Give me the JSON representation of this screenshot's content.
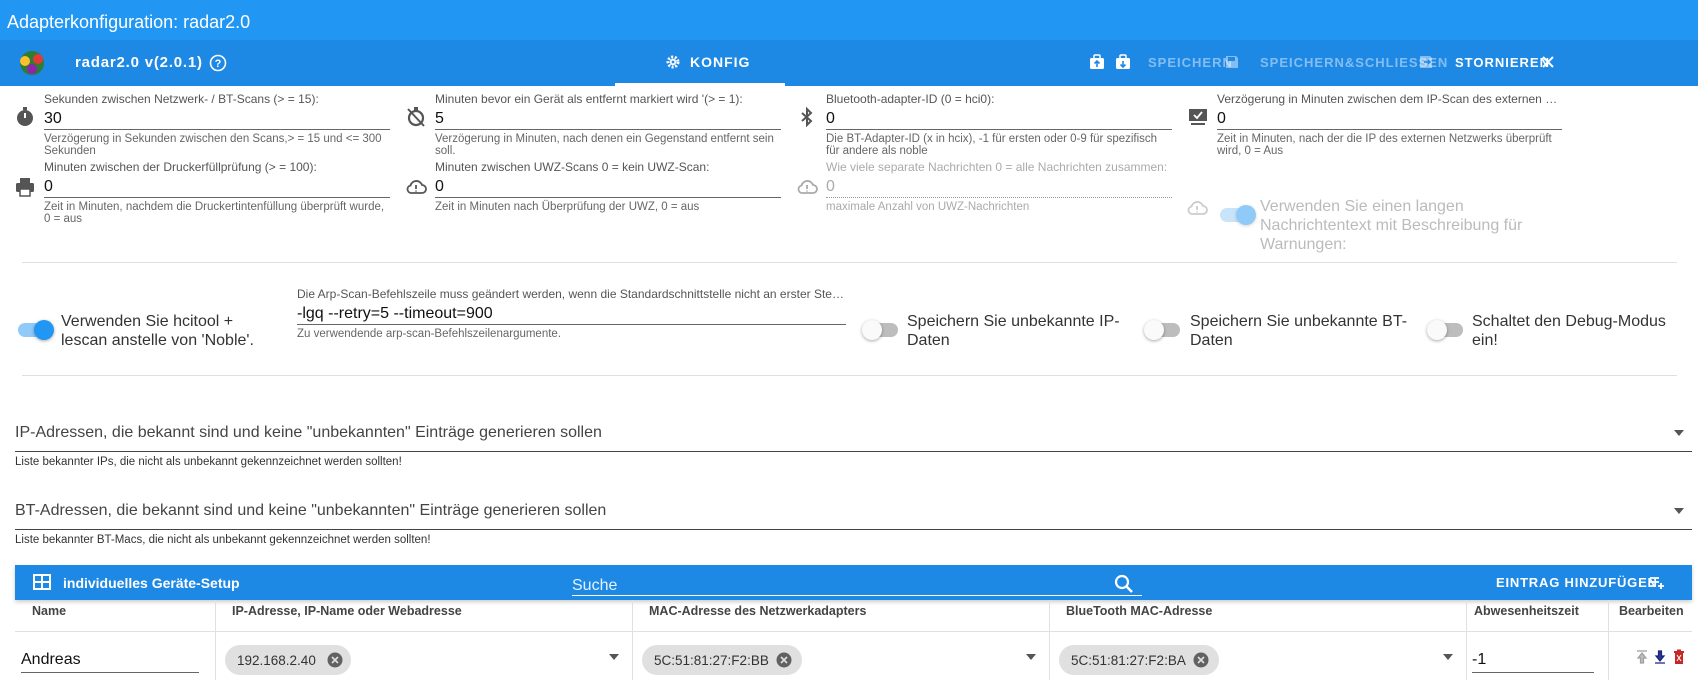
{
  "window": {
    "title": "Adapterkonfiguration: radar2.0"
  },
  "toolbar": {
    "adapter_name": "radar2.0 v(2.0.1)",
    "tab_label": "KONFIG",
    "save_label": "SPEICHERN",
    "save_close_label": "SPEICHERN&SCHLIESSEN",
    "cancel_label": "STORNIEREN"
  },
  "fields": {
    "scan_seconds": {
      "label": "Sekunden zwischen Netzwerk- / BT-Scans (> = 15):",
      "value": "30",
      "help": "Verzögerung in Sekunden zwischen den Scans,> = 15 und <= 300 Sekunden"
    },
    "remove_minutes": {
      "label": "Minuten bevor ein Gerät als entfernt markiert wird '(> = 1):",
      "value": "5",
      "help": "Verzögerung in Minuten, nach denen ein Gegenstand entfernt sein soll."
    },
    "bt_adapter": {
      "label": "Bluetooth-adapter-ID (0 = hci0):",
      "value": "0",
      "help": "Die BT-Adapter-ID (x in hcix), -1 für ersten oder 0-9 für spezifisch für andere als noble"
    },
    "ext_ip_delay": {
      "label": "Verzögerung in Minuten zwischen dem IP-Scan des externen Netzwe...",
      "value": "0",
      "help": "Zeit in Minuten, nach der die IP des externen Netzwerks überprüft wird, 0 = Aus"
    },
    "printer_minutes": {
      "label": "Minuten zwischen der Druckerfüllprüfung (> = 100):",
      "value": "0",
      "help": "Zeit in Minuten, nachdem die Druckertintenfüllung überprüft wurde, 0 = aus"
    },
    "uwz_minutes": {
      "label": "Minuten zwischen UWZ-Scans 0 = kein UWZ-Scan:",
      "value": "0",
      "help": "Zeit in Minuten nach Überprüfung der UWZ, 0 = aus"
    },
    "uwz_messages": {
      "label": "Wie viele separate Nachrichten 0 = alle Nachrichten zusammen:",
      "value": "0",
      "help": "maximale Anzahl von UWZ-Nachrichten"
    },
    "arp_cmd": {
      "label": "Die Arp-Scan-Befehlszeile muss geändert werden, wenn die Standardschnittstelle nicht an erster Stell...",
      "value": "-lgq --retry=5 --timeout=900",
      "help": "Zu verwendende arp-scan-Befehlszeilenargumente."
    }
  },
  "toggles": {
    "long_message": {
      "label": "Verwenden Sie einen langen Nachrichtentext mit Beschreibung für Warnungen:",
      "on": true
    },
    "hcitool": {
      "label": "Verwenden Sie hcitool + lescan anstelle von 'Noble'.",
      "on": true
    },
    "unknown_ip": {
      "label": "Speichern Sie unbekannte IP-Daten",
      "on": false
    },
    "unknown_bt": {
      "label": "Speichern Sie unbekannte BT-Daten",
      "on": false
    },
    "debug": {
      "label": "Schaltet den Debug-Modus ein!",
      "on": false
    }
  },
  "selects": {
    "known_ips": {
      "label": "IP-Adressen, die bekannt sind und keine \"unbekannten\" Einträge generieren sollen",
      "help": "Liste bekannter IPs, die nicht als unbekannt gekennzeichnet werden sollten!"
    },
    "known_bt": {
      "label": "BT-Adressen, die bekannt sind und keine \"unbekannten\" Einträge generieren sollen",
      "help": "Liste bekannter BT-Macs, die nicht als unbekannt gekennzeichnet werden sollten!"
    }
  },
  "table": {
    "title": "individuelles Geräte-Setup",
    "search_placeholder": "Suche",
    "add_label": "EINTRAG HINZUFÜGEN",
    "columns": [
      "Name",
      "IP-Adresse, IP-Name oder Webadresse",
      "MAC-Adresse des Netzwerkadapters",
      "BlueTooth MAC-Adresse",
      "Abwesenheitszeit",
      "Bearbeiten"
    ],
    "rows": [
      {
        "name": "Andreas",
        "ip": "192.168.2.40",
        "mac": "5C:51:81:27:F2:BB",
        "bt": "5C:51:81:27:F2:BA",
        "absence": "-1"
      }
    ]
  },
  "colors": {
    "primary": "#1e88e5",
    "title_bar": "#2196f3",
    "toggle_on": "#2196f3",
    "delete": "#c62828"
  }
}
